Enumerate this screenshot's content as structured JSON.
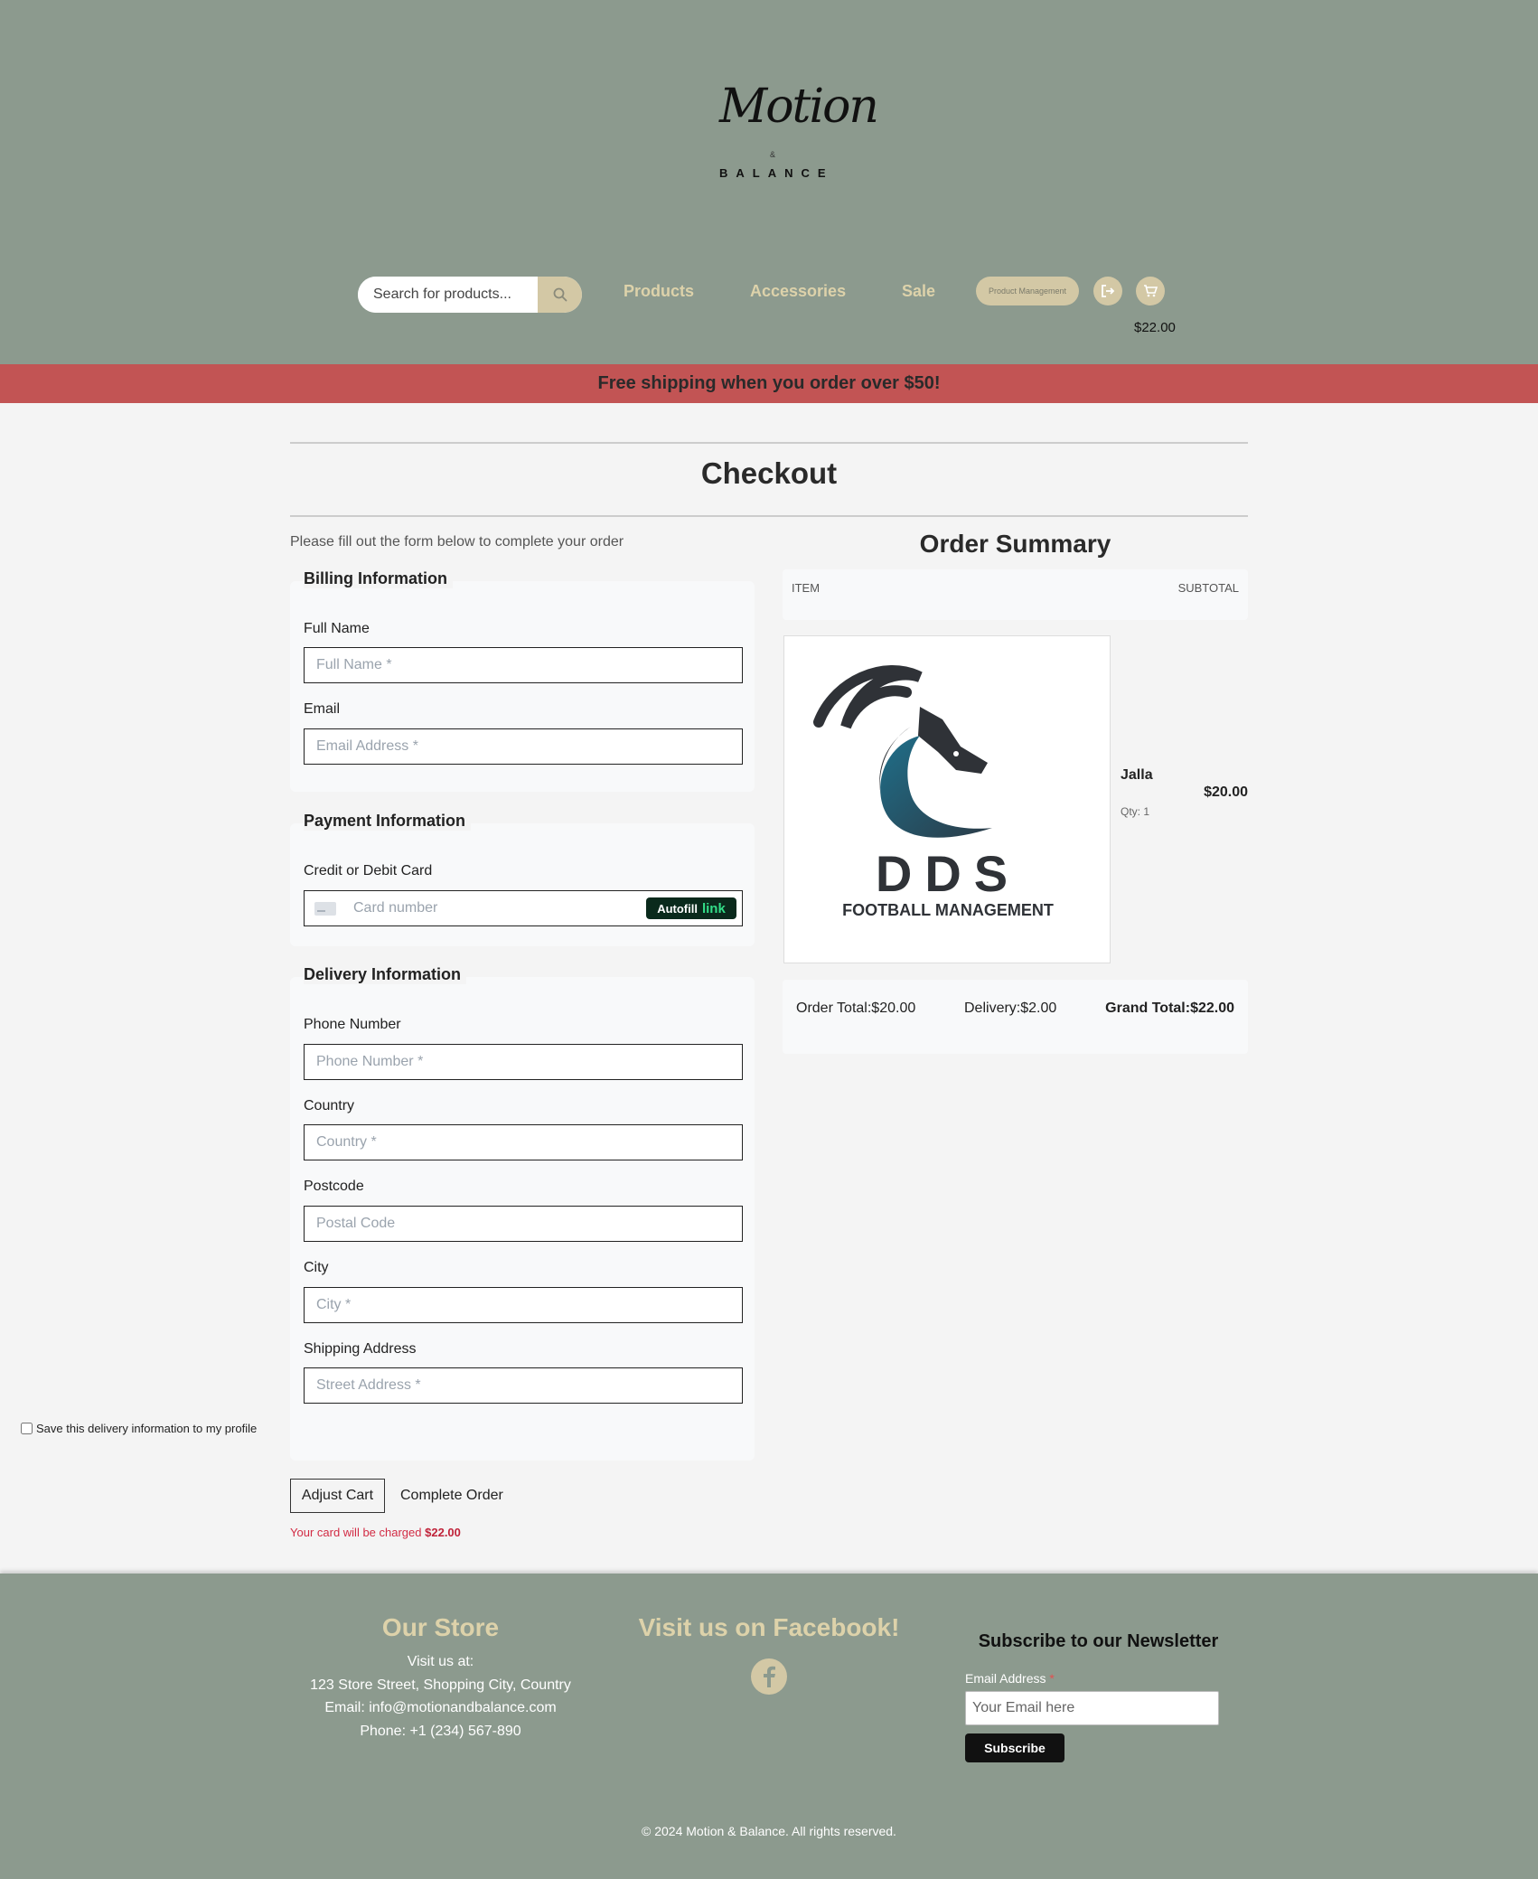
{
  "brand": {
    "logo_script": "Motion",
    "logo_amp": "&",
    "logo_sub": "BALANCE"
  },
  "search": {
    "placeholder": "Search for products..."
  },
  "nav": {
    "items": [
      {
        "label": "Products"
      },
      {
        "label": "Accessories"
      },
      {
        "label": "Sale"
      }
    ],
    "product_management_label": "Product Management",
    "icons": [
      "logout-icon",
      "cart-icon"
    ],
    "cart_total": "$22.00"
  },
  "banner": {
    "text": "Free shipping when you order over $50!"
  },
  "checkout": {
    "title": "Checkout",
    "intro": "Please fill out the form below to complete your order",
    "billing": {
      "title": "Billing Information",
      "full_name_label": "Full Name",
      "full_name_placeholder": "Full Name *",
      "email_label": "Email",
      "email_placeholder": "Email Address *"
    },
    "payment": {
      "title": "Payment Information",
      "card_label": "Credit or Debit Card",
      "card_placeholder": "Card number",
      "autofill_text": "Autofill",
      "autofill_link": "link"
    },
    "delivery": {
      "title": "Delivery Information",
      "phone_label": "Phone Number",
      "phone_placeholder": "Phone Number *",
      "country_label": "Country",
      "country_placeholder": "Country *",
      "postcode_label": "Postcode",
      "postcode_placeholder": "Postal Code",
      "city_label": "City",
      "city_placeholder": "City *",
      "address_label": "Shipping Address",
      "address_placeholder": "Street Address *",
      "save_label": "Save this delivery information to my profile"
    },
    "adjust_cart_label": "Adjust Cart",
    "complete_order_label": "Complete Order",
    "charge_text": "Your card will be charged",
    "charge_amount": "$22.00"
  },
  "order_summary": {
    "title": "Order Summary",
    "col_item": "ITEM",
    "col_subtotal": "SUBTOTAL",
    "item": {
      "name": "Jalla",
      "qty": "Qty: 1",
      "price": "$20.00",
      "image_text_main": "DDS",
      "image_text_sub": "FOOTBALL MANAGEMENT"
    },
    "order_total": "Order Total:$20.00",
    "delivery": "Delivery:$2.00",
    "grand_total": "Grand Total:$22.00"
  },
  "footer": {
    "store_title": "Our Store",
    "visit_label": "Visit us at:",
    "address": "123 Store Street, Shopping City, Country",
    "email": "Email: info@motionandbalance.com",
    "phone": "Phone: +1 (234) 567-890",
    "facebook_title": "Visit us on Facebook!",
    "newsletter_title": "Subscribe to our Newsletter",
    "email_label": "Email Address",
    "email_required": "*",
    "email_placeholder": "Your Email here",
    "subscribe_label": "Subscribe",
    "copyright": "© 2024 Motion & Balance. All rights reserved."
  }
}
